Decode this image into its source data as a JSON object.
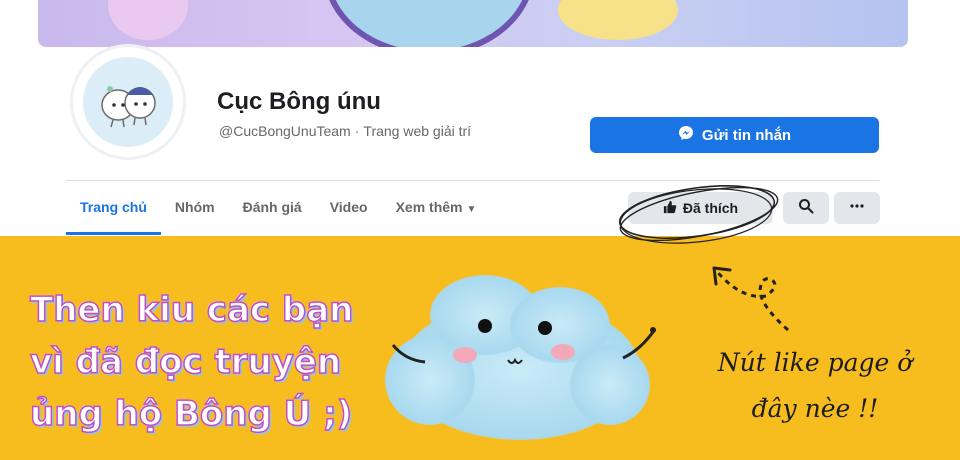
{
  "page": {
    "name": "Cục Bông únu",
    "handle": "@CucBongUnuTeam",
    "separator": "·",
    "category": "Trang web giải trí"
  },
  "actions": {
    "message_label": "Gửi tin nhắn",
    "liked_label": "Đã thích"
  },
  "tabs": [
    {
      "label": "Trang chủ",
      "active": true
    },
    {
      "label": "Nhóm"
    },
    {
      "label": "Đánh giá"
    },
    {
      "label": "Video"
    },
    {
      "label": "Xem thêm"
    }
  ],
  "banner": {
    "lines": [
      "Then kiu các bạn",
      "vì đã đọc truyện",
      "ủng hộ Bông Ú ;)"
    ],
    "note_lines": [
      "Nút like page ở",
      "đây nèe !!"
    ]
  },
  "icons": {
    "messenger": "messenger-icon",
    "like": "thumbs-up-icon",
    "search": "search-icon",
    "more": "more-dots-icon",
    "caret": "caret-down-icon"
  },
  "colors": {
    "accent": "#1b74e4",
    "banner_bg": "#f7bc1e",
    "button_gray": "#e4e6eb"
  }
}
